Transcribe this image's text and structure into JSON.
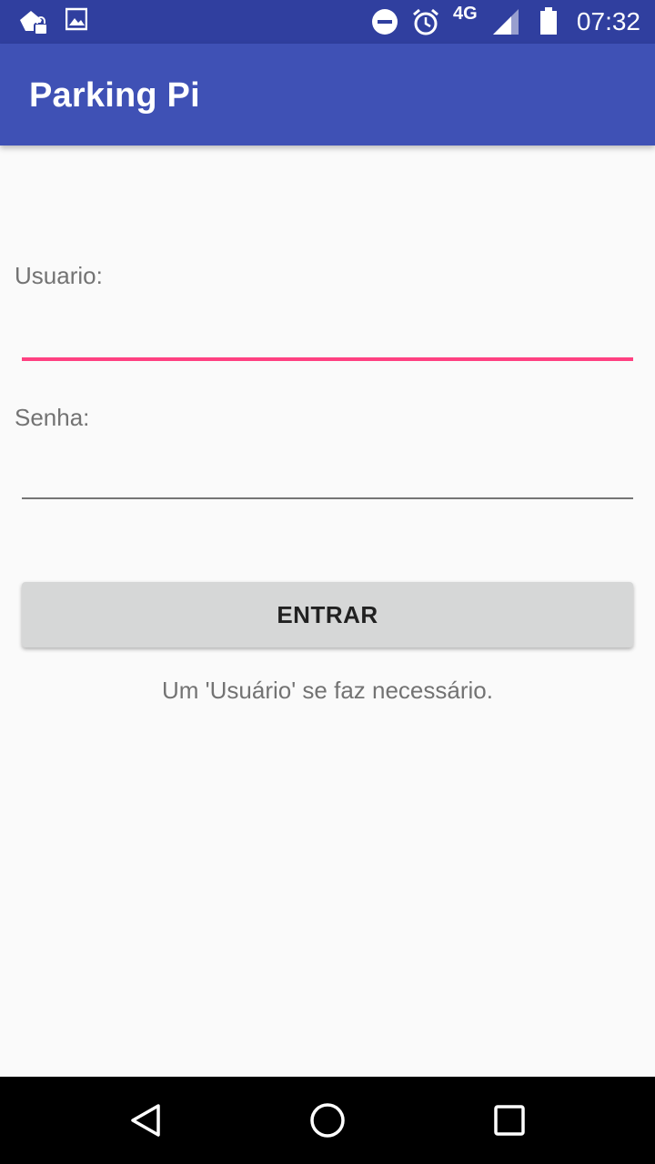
{
  "status_bar": {
    "time": "07:32",
    "network": "4G",
    "icons": [
      "notification-lock-icon",
      "image-icon",
      "do-not-disturb-icon",
      "alarm-icon",
      "signal-icon",
      "battery-icon"
    ]
  },
  "app_bar": {
    "title": "Parking Pi"
  },
  "login_form": {
    "username_label": "Usuario:",
    "username_value": "",
    "password_label": "Senha:",
    "password_value": "",
    "submit_label": "ENTRAR",
    "validation_message": "Um 'Usuário' se faz necessário."
  },
  "colors": {
    "primary": "#3f51b5",
    "primary_dark": "#303f9f",
    "accent": "#ff4081"
  },
  "nav_bar": {
    "icons": [
      "back-icon",
      "home-icon",
      "recents-icon"
    ]
  }
}
